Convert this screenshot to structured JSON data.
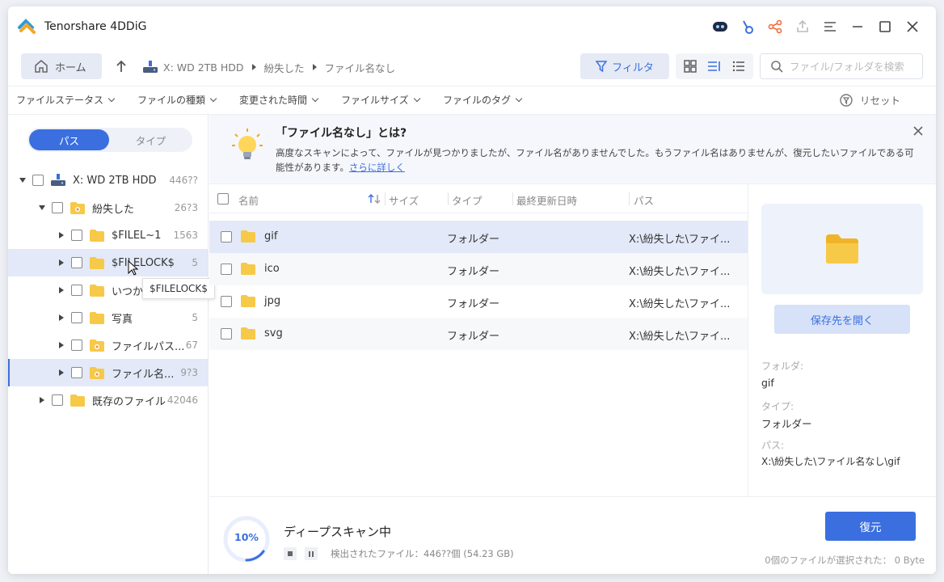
{
  "app": {
    "title": "Tenorshare 4DDiG"
  },
  "nav": {
    "home_label": "ホーム",
    "breadcrumb": [
      "X: WD 2TB HDD",
      "紛失した",
      "ファイル名なし"
    ],
    "filter_label": "フィルタ",
    "search_placeholder": "ファイル/フォルダを検索"
  },
  "filters": {
    "items": [
      "ファイルステータス",
      "ファイルの種類",
      "変更された時間",
      "ファイルサイズ",
      "ファイルのタグ"
    ],
    "reset_label": "リセット"
  },
  "sidebar": {
    "tabs": {
      "active": "パス",
      "other": "タイプ"
    },
    "tree": [
      {
        "label": "X: WD 2TB HDD",
        "count": "446??"
      },
      {
        "label": "紛失した",
        "count": "26?3"
      },
      {
        "label": "$FILEL~1",
        "count": "1563"
      },
      {
        "label": "$FILELOCK$",
        "count": "5"
      },
      {
        "label": "いつか",
        "count": ""
      },
      {
        "label": "写真",
        "count": "5"
      },
      {
        "label": "ファイルパス...",
        "count": "67"
      },
      {
        "label": "ファイル名...",
        "count": "9?3"
      },
      {
        "label": "既存のファイル",
        "count": "42046"
      }
    ],
    "tooltip": "$FILELOCK$"
  },
  "banner": {
    "title": "「ファイル名なし」とは?",
    "text": "高度なスキャンによって、ファイルが見つかりましたが、ファイル名がありませんでした。もうファイル名はありませんが、復元したいファイルである可能性があります。",
    "link": "さらに詳しく"
  },
  "list": {
    "headers": {
      "name": "名前",
      "size": "サイズ",
      "type": "タイプ",
      "modified": "最終更新日時",
      "path": "パス"
    },
    "rows": [
      {
        "name": "gif",
        "type": "フォルダー",
        "path": "X:\\紛失した\\ファイ..."
      },
      {
        "name": "ico",
        "type": "フォルダー",
        "path": "X:\\紛失した\\ファイ..."
      },
      {
        "name": "jpg",
        "type": "フォルダー",
        "path": "X:\\紛失した\\ファイ..."
      },
      {
        "name": "svg",
        "type": "フォルダー",
        "path": "X:\\紛失した\\ファイ..."
      }
    ]
  },
  "preview": {
    "open_label": "保存先を開く",
    "folder_label": "フォルダ:",
    "folder_value": "gif",
    "type_label": "タイプ:",
    "type_value": "フォルダー",
    "path_label": "パス:",
    "path_value": "X:\\紛失した\\ファイル名なし\\gif"
  },
  "footer": {
    "progress": "10%",
    "scan_title": "ディープスキャン中",
    "scan_status": "検出されたファイル：446??個 (54.23 GB)",
    "recover_label": "復元",
    "selected_info": "0個のファイルが選択された： 0 Byte"
  },
  "colors": {
    "accent": "#3b6fe0",
    "folder": "#f7c948",
    "selected_row": "#e3e9f8"
  },
  "icons": [
    "app-logo-icon",
    "robot-icon",
    "key-icon",
    "share-icon",
    "upload-icon",
    "menu-icon",
    "minimize-icon",
    "maximize-icon",
    "close-icon",
    "home-icon",
    "up-arrow-icon",
    "drive-icon",
    "filter-icon",
    "grid-view-icon",
    "detail-view-icon",
    "list-view-icon",
    "search-icon",
    "reset-icon",
    "folder-icon",
    "lightbulb-icon",
    "stop-icon",
    "pause-icon"
  ]
}
